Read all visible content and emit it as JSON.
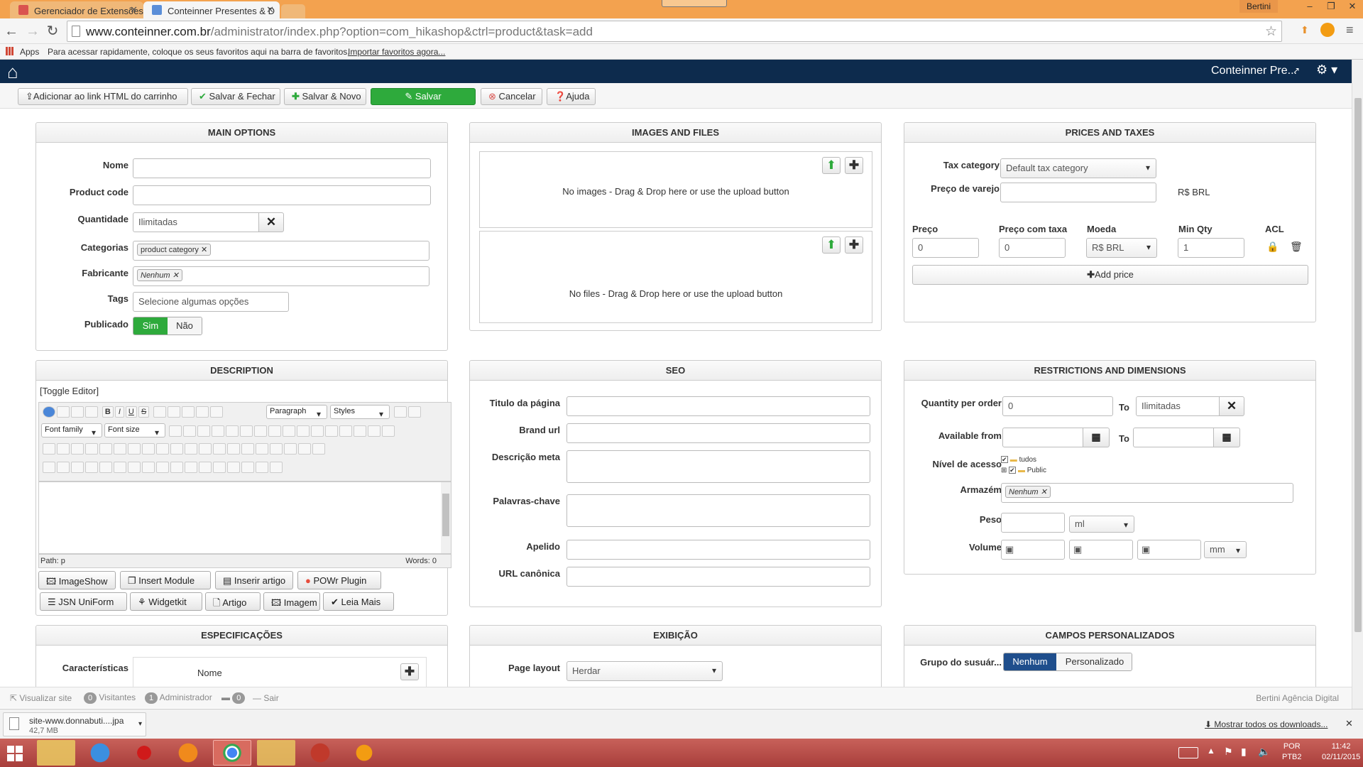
{
  "browser": {
    "tabs": [
      {
        "title": "Gerenciador de Extensões",
        "active": false
      },
      {
        "title": "Conteinner Presentes & D",
        "active": true
      }
    ],
    "user": "Bertini",
    "url_host": "www.conteinner.com.br",
    "url_path": "/administrator/index.php?option=com_hikashop&ctrl=product&task=add",
    "bookmarks_apps": "Apps",
    "bookmarks_msg": "Para acessar rapidamente, coloque os seus favoritos aqui na barra de favoritos.",
    "bookmarks_import": "Importar favoritos agora..."
  },
  "admin": {
    "site_title": "Conteinner Pre..."
  },
  "toolbar": {
    "add_link": "Adicionar ao link HTML do carrinho",
    "save_close": "Salvar & Fechar",
    "save_new": "Salvar & Novo",
    "save": "Salvar",
    "cancel": "Cancelar",
    "help": "Ajuda"
  },
  "main_options": {
    "title": "MAIN OPTIONS",
    "name_label": "Nome",
    "code_label": "Product code",
    "qty_label": "Quantidade",
    "qty_value": "Ilimitadas",
    "cat_label": "Categorias",
    "cat_tag": "product category",
    "mfr_label": "Fabricante",
    "mfr_tag": "Nenhum",
    "tags_label": "Tags",
    "tags_placeholder": "Selecione algumas opções",
    "pub_label": "Publicado",
    "pub_yes": "Sim",
    "pub_no": "Não"
  },
  "images": {
    "title": "IMAGES AND FILES",
    "no_images": "No images - Drag & Drop here or use the upload button",
    "no_files": "No files - Drag & Drop here or use the upload button"
  },
  "prices": {
    "title": "PRICES AND TAXES",
    "tax_label": "Tax category",
    "tax_value": "Default tax category",
    "retail_label": "Preço de varejo",
    "retail_currency": "R$ BRL",
    "col_price": "Preço",
    "col_price_tax": "Preço com taxa",
    "col_currency": "Moeda",
    "col_min_qty": "Min Qty",
    "col_acl": "ACL",
    "price_value": "0",
    "price_tax_value": "0",
    "currency_value": "R$ BRL",
    "min_qty_value": "1",
    "add_price": "Add price"
  },
  "description": {
    "title": "DESCRIPTION",
    "toggle": "[Toggle Editor]",
    "paragraph": "Paragraph",
    "styles": "Styles",
    "font_family": "Font family",
    "font_size": "Font size",
    "path": "Path:  p",
    "words": "Words: 0",
    "buttons": [
      "ImageShow",
      "Insert Module",
      "Inserir artigo",
      "POWr Plugin",
      "JSN UniForm",
      "Widgetkit",
      "Artigo",
      "Imagem",
      "Leia Mais"
    ]
  },
  "seo": {
    "title": "SEO",
    "page_title": "Titulo da página",
    "brand_url": "Brand url",
    "meta_desc": "Descrição meta",
    "keywords": "Palavras-chave",
    "alias": "Apelido",
    "canonical": "URL canônica"
  },
  "restrictions": {
    "title": "RESTRICTIONS AND DIMENSIONS",
    "qty_order": "Quantity per order",
    "qty_min": "0",
    "to": "To",
    "qty_max": "Ilimitadas",
    "available_from": "Available from",
    "access_level": "Nível de acesso",
    "access_all": "tudos",
    "access_public": "Public",
    "warehouse": "Armazém",
    "warehouse_tag": "Nenhum",
    "weight": "Peso",
    "weight_unit": "ml",
    "volume": "Volume",
    "volume_unit": "mm"
  },
  "specs": {
    "title": "ESPECIFICAÇÕES",
    "features": "Características",
    "name_col": "Nome"
  },
  "display": {
    "title": "EXIBIÇÃO",
    "page_layout": "Page layout",
    "layout_value": "Herdar"
  },
  "custom": {
    "title": "CAMPOS PERSONALIZADOS",
    "user_group": "Grupo do susuár...",
    "opt_none": "Nenhum",
    "opt_custom": "Personalizado"
  },
  "status": {
    "view_site": "Visualizar site",
    "visitors_count": "0",
    "visitors": "Visitantes",
    "admin_count": "1",
    "admin": "Administrador",
    "msg_count": "0",
    "logout": "Sair",
    "agency": "Bertini Agência Digital"
  },
  "download": {
    "file": "site-www.donnabuti....jpa",
    "size": "42,7 MB",
    "show_all": "Mostrar todos os downloads..."
  },
  "taskbar": {
    "lang1": "POR",
    "lang2": "PTB2",
    "time": "11:42",
    "date": "02/11/2015"
  },
  "colors": {
    "admin_header": "#0d2b4d",
    "success": "#2eaa3c",
    "primary": "#1f4e8c",
    "titlebar": "#f3a24f",
    "taskbar": "#b5463f"
  }
}
